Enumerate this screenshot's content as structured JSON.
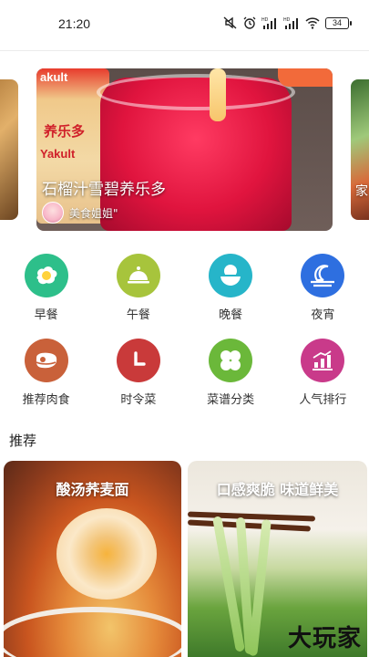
{
  "status": {
    "time": "21:20",
    "battery": "34"
  },
  "carousel": {
    "main": {
      "title": "石榴汁雪碧养乐多",
      "author": "美食姐姐\"",
      "bottle_brand_top": "akult",
      "bottle_brand_mid": "养乐多",
      "bottle_brand_bottom": "Yakult"
    },
    "right_partial_text": "家"
  },
  "categories_row1": [
    {
      "label": "早餐",
      "icon": "fried-egg-icon",
      "color": "#2dbf8a"
    },
    {
      "label": "午餐",
      "icon": "cloche-icon",
      "color": "#a7c43c"
    },
    {
      "label": "晚餐",
      "icon": "bowl-icon",
      "color": "#26b5c9"
    },
    {
      "label": "夜宵",
      "icon": "moon-icon",
      "color": "#2e6fe0"
    }
  ],
  "categories_row2": [
    {
      "label": "推荐肉食",
      "icon": "meat-icon",
      "color": "#c9613a"
    },
    {
      "label": "时令菜",
      "icon": "clock-icon",
      "color": "#c93a3a"
    },
    {
      "label": "菜谱分类",
      "icon": "grid-icon",
      "color": "#6bb83a"
    },
    {
      "label": "人气排行",
      "icon": "ranking-icon",
      "color": "#c93a8a"
    }
  ],
  "section": {
    "title": "推荐"
  },
  "recommend": [
    {
      "title": "酸汤荞麦面"
    },
    {
      "title": "口感爽脆 味道鲜美"
    }
  ],
  "watermark": "大玩家"
}
